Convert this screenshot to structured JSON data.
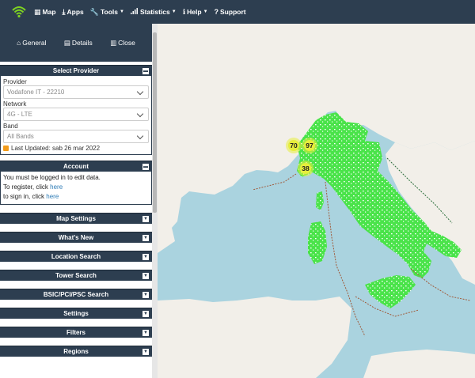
{
  "nav": {
    "map": "Map",
    "apps": "Apps",
    "tools": "Tools",
    "statistics": "Statistics",
    "help": "Help",
    "support": "Support"
  },
  "sidebar_tabs": {
    "general": "General",
    "details": "Details",
    "close": "Close"
  },
  "select_provider": {
    "title": "Select Provider",
    "provider_label": "Provider",
    "provider_value": "Vodafone IT - 22210",
    "network_label": "Network",
    "network_value": "4G - LTE",
    "band_label": "Band",
    "band_value": "All Bands",
    "last_updated": "Last Updated: sab 26 mar 2022"
  },
  "account": {
    "title": "Account",
    "line1": "You must be logged in to edit data.",
    "line2_prefix": "To register, click ",
    "line3_prefix": "to sign in, click ",
    "link": "here"
  },
  "panels": [
    {
      "label": "Map Settings"
    },
    {
      "label": "What's New"
    },
    {
      "label": "Location Search"
    },
    {
      "label": "Tower Search"
    },
    {
      "label": "BSIC/PCI/PSC Search"
    },
    {
      "label": "Settings"
    },
    {
      "label": "Filters"
    },
    {
      "label": "Regions"
    }
  ],
  "clusters": [
    {
      "count": "70"
    },
    {
      "count": "97"
    },
    {
      "count": "38"
    }
  ],
  "colors": {
    "nav_bg": "#2d3e50",
    "sea": "#aad3df",
    "land": "#f2efe9",
    "coverage": "#4ae34a",
    "cluster": "#e7ee3c"
  }
}
